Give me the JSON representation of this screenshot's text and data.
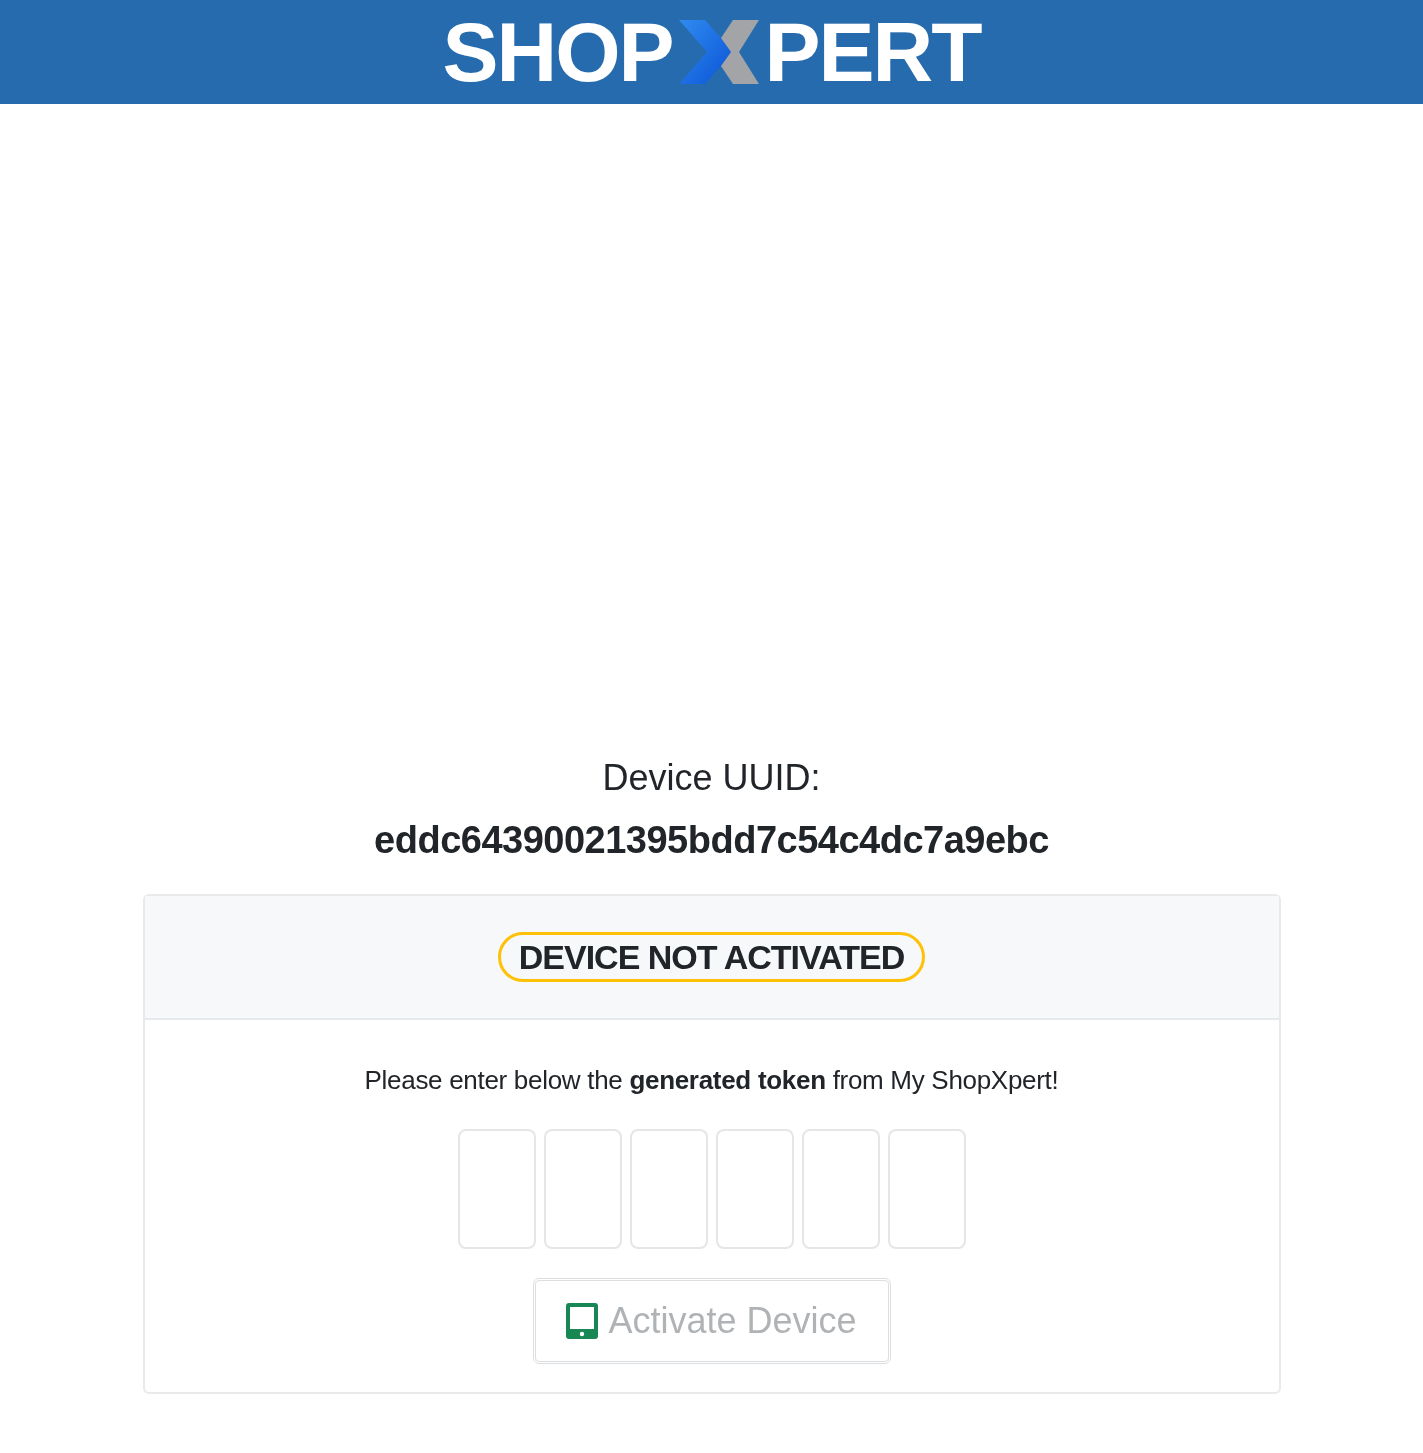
{
  "header": {
    "logo_left": "SHOP",
    "logo_right": "PERT"
  },
  "device": {
    "label": "Device UUID:",
    "uuid": "eddc64390021395bdd7c54c4dc7a9ebc"
  },
  "activation_card": {
    "status_badge": "DEVICE NOT ACTIVATED",
    "instruction": "Please enter below the **generated token** from My ShopXpert!",
    "token_inputs": [
      {
        "kind": "digit"
      },
      {
        "kind": "digit"
      },
      {
        "kind": "digit"
      },
      {
        "kind": "digit"
      },
      {
        "kind": "digit"
      },
      {
        "kind": "digit"
      }
    ],
    "activate_button": {
      "label": "Activate Device",
      "disabled": true
    }
  }
}
